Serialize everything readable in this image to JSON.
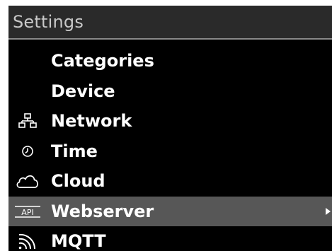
{
  "title": "Settings",
  "menu": {
    "items": [
      {
        "label": "Categories",
        "icon": null
      },
      {
        "label": "Device",
        "icon": null
      },
      {
        "label": "Network",
        "icon": "network-icon"
      },
      {
        "label": "Time",
        "icon": "clock-icon"
      },
      {
        "label": "Cloud",
        "icon": "cloud-icon"
      },
      {
        "label": "Webserver",
        "icon": "api-icon",
        "icon_text": "API",
        "selected": true
      },
      {
        "label": "MQTT",
        "icon": "signal-icon"
      }
    ]
  },
  "colors": {
    "background": "#000000",
    "titlebar": "#2a2a2a",
    "title_text": "#c8c8c8",
    "selected_row": "#575757",
    "text": "#ffffff"
  }
}
